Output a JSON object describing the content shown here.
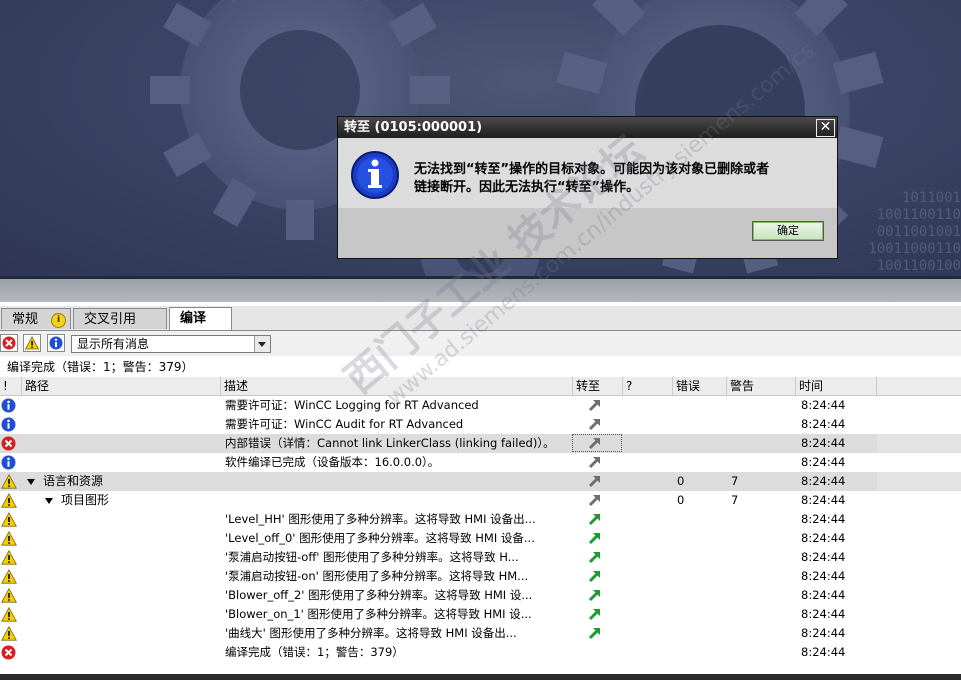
{
  "background": {
    "binary_text": "1011001\n1001100110\n0011001001\n10011000110\n1001100100"
  },
  "dialog": {
    "title": "转至 (0105:000001)",
    "message_line1": "无法找到“转至”操作的目标对象。可能因为该对象已删除或者",
    "message_line2": "链接断开。因此无法执行“转至”操作。",
    "ok_label": "确定",
    "close_glyph": "✕"
  },
  "tabs": [
    {
      "label": "常规"
    },
    {
      "label": "交叉引用"
    },
    {
      "label": "编译"
    }
  ],
  "tabs_info_glyph": "i",
  "filter": {
    "selected": "显示所有消息"
  },
  "summary": "编译完成（错误：1；警告：379）",
  "columns": {
    "severity": "!",
    "path": "路径",
    "description": "描述",
    "goto": "转至",
    "question": "?",
    "errors": "错误",
    "warnings": "警告",
    "time": "时间"
  },
  "rows": [
    {
      "type": "info",
      "path": "",
      "description": "需要许可证：WinCC Logging for RT Advanced",
      "goto": "gray",
      "errors": "",
      "warnings": "",
      "time": "8:24:44"
    },
    {
      "type": "info",
      "path": "",
      "description": "需要许可证：WinCC Audit for RT Advanced",
      "goto": "gray",
      "errors": "",
      "warnings": "",
      "time": "8:24:44"
    },
    {
      "type": "error",
      "path": "",
      "description": "内部错误（详情：Cannot link LinkerClass (linking failed)）。",
      "goto": "gray",
      "errors": "",
      "warnings": "",
      "time": "8:24:44"
    },
    {
      "type": "info",
      "path": "",
      "description": "软件编译已完成（设备版本：16.0.0.0）。",
      "goto": "gray",
      "errors": "",
      "warnings": "",
      "time": "8:24:44"
    },
    {
      "type": "warning",
      "path": "语言和资源",
      "description": "",
      "goto": "gray",
      "errors": "0",
      "warnings": "7",
      "time": "8:24:44"
    },
    {
      "type": "warning",
      "path": "项目图形",
      "description": "",
      "goto": "gray",
      "errors": "0",
      "warnings": "7",
      "time": "8:24:44"
    },
    {
      "type": "warning",
      "path": "",
      "description": "'Level_HH' 图形使用了多种分辨率。这将导致 HMI 设备出...",
      "goto": "green",
      "errors": "",
      "warnings": "",
      "time": "8:24:44"
    },
    {
      "type": "warning",
      "path": "",
      "description": "'Level_off_0' 图形使用了多种分辨率。这将导致 HMI 设备...",
      "goto": "green",
      "errors": "",
      "warnings": "",
      "time": "8:24:44"
    },
    {
      "type": "warning",
      "path": "",
      "description": "'泵浦启动按钮-off' 图形使用了多种分辨率。这将导致 H...",
      "goto": "green",
      "errors": "",
      "warnings": "",
      "time": "8:24:44"
    },
    {
      "type": "warning",
      "path": "",
      "description": "'泵浦启动按钮-on' 图形使用了多种分辨率。这将导致 HM...",
      "goto": "green",
      "errors": "",
      "warnings": "",
      "time": "8:24:44"
    },
    {
      "type": "warning",
      "path": "",
      "description": "'Blower_off_2' 图形使用了多种分辨率。这将导致 HMI 设...",
      "goto": "green",
      "errors": "",
      "warnings": "",
      "time": "8:24:44"
    },
    {
      "type": "warning",
      "path": "",
      "description": "'Blower_on_1' 图形使用了多种分辨率。这将导致 HMI 设...",
      "goto": "green",
      "errors": "",
      "warnings": "",
      "time": "8:24:44"
    },
    {
      "type": "warning",
      "path": "",
      "description": "'曲线大' 图形使用了多种分辨率。这将导致 HMI 设备出...",
      "goto": "green",
      "errors": "",
      "warnings": "",
      "time": "8:24:44"
    },
    {
      "type": "error",
      "path": "",
      "description": "编译完成（错误：1；警告：379）",
      "goto": "",
      "errors": "",
      "warnings": "",
      "time": "8:24:44"
    }
  ],
  "watermark": {
    "line1": "西门子工业  技术论坛",
    "line2": "www.ad.siemens.com.cn/industry.siemens.com/cs"
  }
}
